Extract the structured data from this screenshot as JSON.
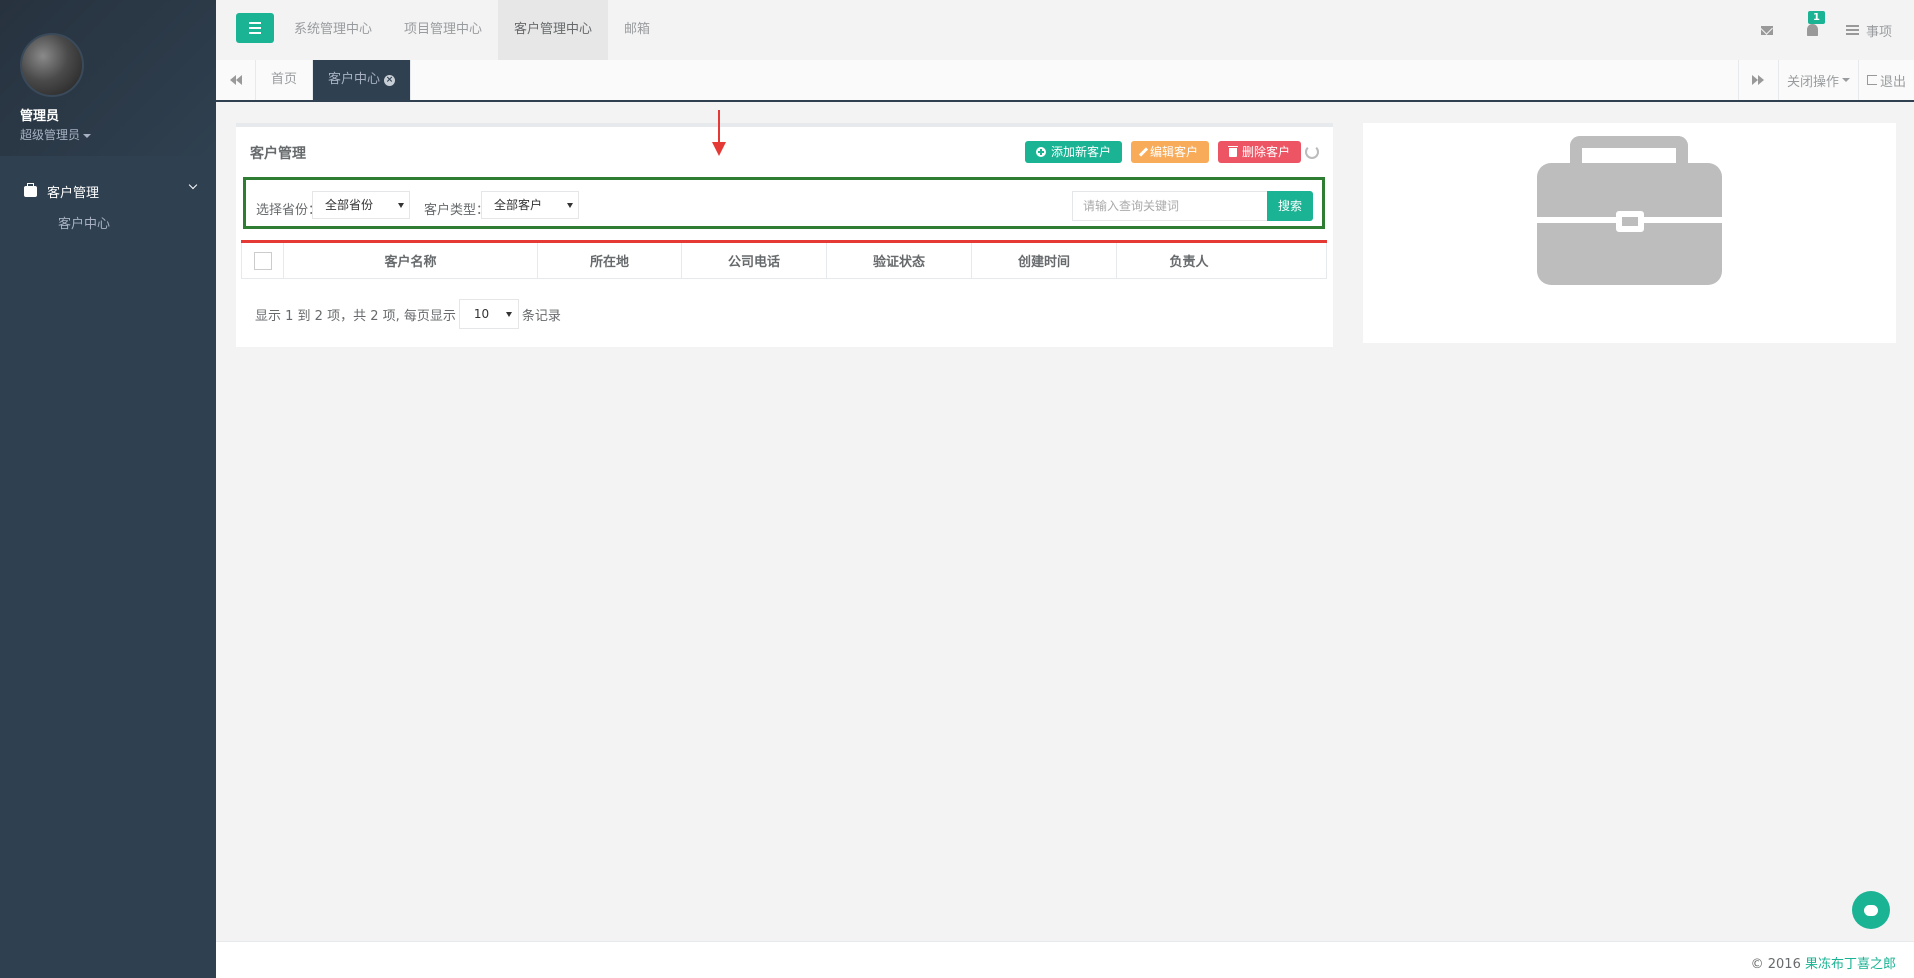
{
  "sidebar": {
    "user_name": "管理员",
    "user_role": "超级管理员",
    "nav_group": "客户管理",
    "nav_sub": "客户中心"
  },
  "topnav": {
    "items": [
      "系统管理中心",
      "项目管理中心",
      "客户管理中心",
      "邮箱"
    ],
    "active": "客户管理中心",
    "notification_count": "1",
    "todo_label": "事项"
  },
  "tabs": {
    "items": [
      "首页",
      "客户中心"
    ],
    "close_ops": "关闭操作",
    "logout": "退出"
  },
  "panel": {
    "title": "客户管理",
    "add_label": "添加新客户",
    "edit_label": "编辑客户",
    "delete_label": "删除客户"
  },
  "filter": {
    "province_label": "选择省份：",
    "province_value": "全部省份",
    "type_label": "客户类型：",
    "type_value": "全部客户",
    "search_placeholder": "请输入查询关键词",
    "search_button": "搜索"
  },
  "table": {
    "columns": [
      "客户名称",
      "所在地",
      "公司电话",
      "验证状态",
      "创建时间",
      "负责人"
    ]
  },
  "pager": {
    "prefix": "显示 1 到 2 项，共 2 项, 每页显示",
    "page_size": "10",
    "suffix": "条记录"
  },
  "footer": {
    "copyright": "© 2016",
    "brand": "果冻布丁喜之郎"
  },
  "colors": {
    "primary": "#1ab394",
    "warning": "#f8ac59",
    "danger": "#ed5565",
    "sidebar": "#2f4050",
    "highlight_box": "#2e7d32",
    "annotation_red": "#e53935"
  }
}
